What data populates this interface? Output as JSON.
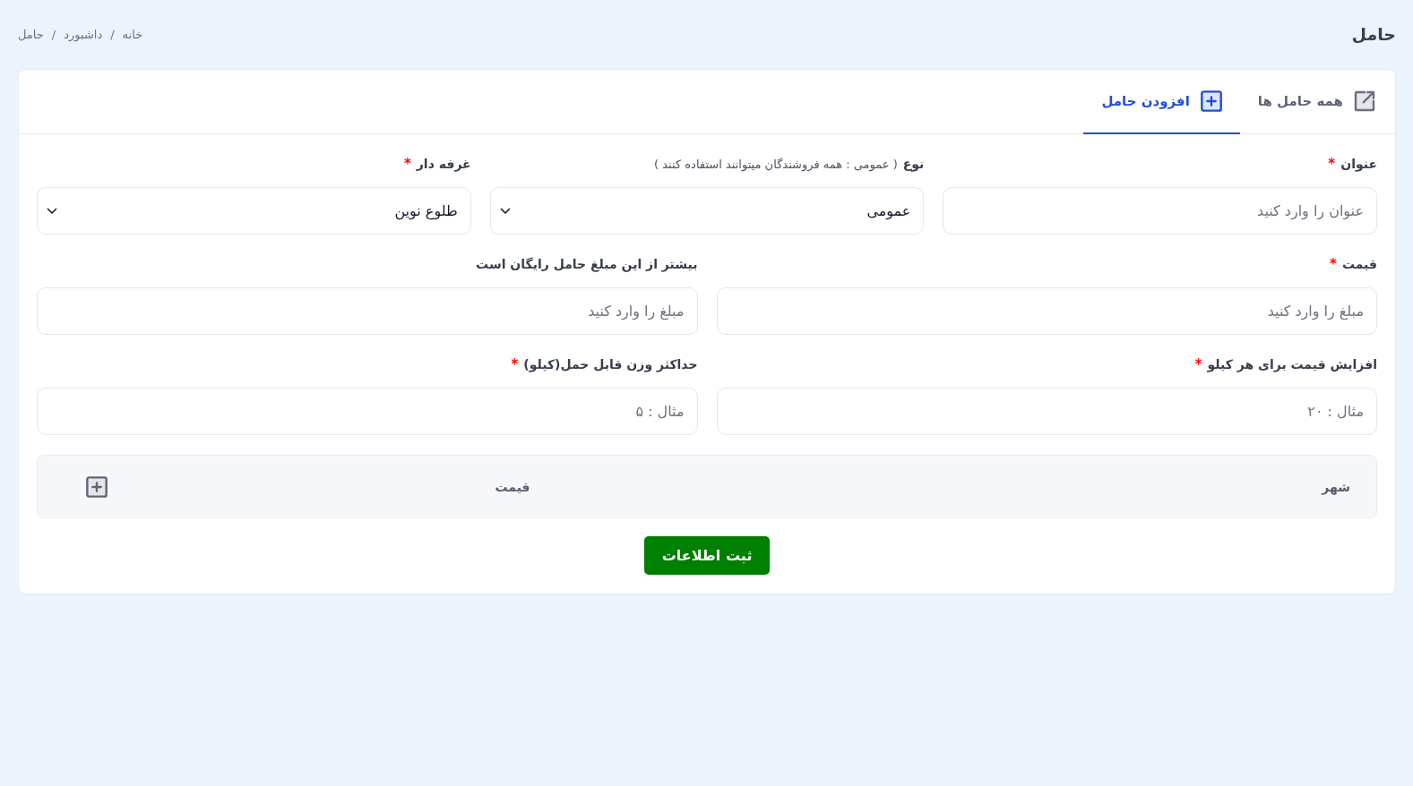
{
  "header": {
    "title": "حامل",
    "breadcrumb": {
      "separator": "/",
      "items": [
        {
          "label": "خانه"
        },
        {
          "label": "داشبورد"
        },
        {
          "label": "حامل"
        }
      ]
    }
  },
  "tabs": [
    {
      "kind": "link",
      "label": "همه حامل ها",
      "selected": false
    },
    {
      "kind": "add",
      "label": "افزودن حامل",
      "selected": true
    }
  ],
  "form": {
    "required_marker": "*",
    "rows": [
      {
        "fields": [
          {
            "kind": "input",
            "label": "عنوان",
            "required": true,
            "placeholder": "عنوان را وارد کنید"
          },
          {
            "kind": "select",
            "label": "نوع",
            "hint": "( عمومی : همه فروشندگان میتوانند استفاده کنند )",
            "required": false,
            "value": "عمومی"
          },
          {
            "kind": "select",
            "label": "غرفه دار",
            "required": true,
            "value": "طلوع نوین"
          }
        ]
      },
      {
        "fields": [
          {
            "kind": "input",
            "label": "قیمت",
            "required": true,
            "placeholder": "مبلغ را وارد کنید"
          },
          {
            "kind": "input",
            "label": "بیشتر از این مبلغ حامل رایگان است",
            "required": false,
            "placeholder": "مبلغ را وارد کنید"
          }
        ]
      },
      {
        "fields": [
          {
            "kind": "input",
            "label": "افزایش قیمت برای هر کیلو",
            "required": true,
            "placeholder": "مثال : ۲۰"
          },
          {
            "kind": "input",
            "label": "حداکثر وزن قابل حمل(کیلو)",
            "required": true,
            "placeholder": "مثال : ۵"
          }
        ]
      }
    ]
  },
  "table": {
    "columns": [
      {
        "label": "شهر"
      },
      {
        "label": "قیمت"
      }
    ]
  },
  "submit_button": {
    "label": "ثبت اطلاعات"
  }
}
